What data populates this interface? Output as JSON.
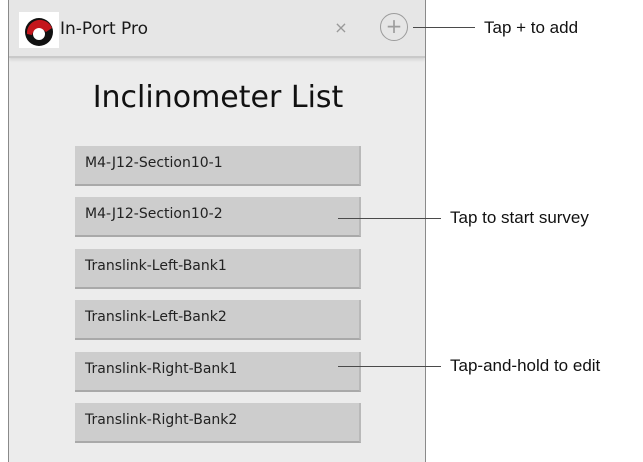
{
  "app": {
    "title": "In-Port Pro",
    "close_glyph": "×",
    "add_glyph": "+",
    "logo_color": "#c4161c"
  },
  "page": {
    "title": "Inclinometer List"
  },
  "list": {
    "items": [
      "M4-J12-Section10-1",
      "M4-J12-Section10-2",
      "Translink-Left-Bank1",
      "Translink-Left-Bank2",
      "Translink-Right-Bank1",
      "Translink-Right-Bank2"
    ]
  },
  "callouts": {
    "add": "Tap + to add",
    "start_survey": "Tap to start survey",
    "edit": "Tap-and-hold to edit"
  }
}
